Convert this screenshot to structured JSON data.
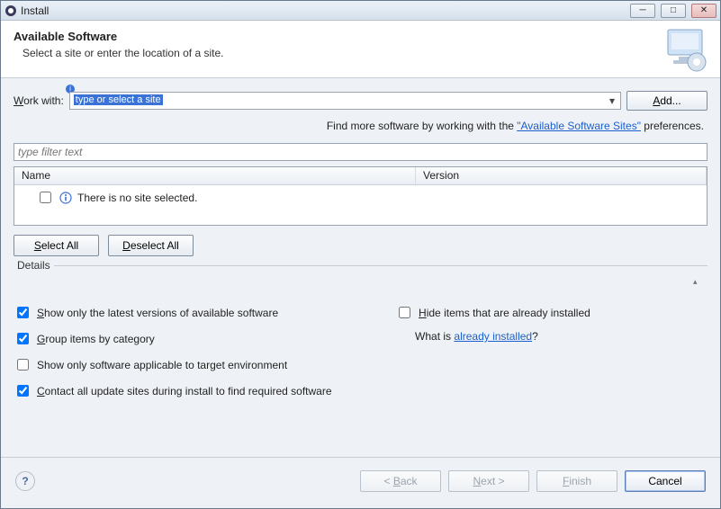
{
  "window": {
    "title": "Install"
  },
  "header": {
    "title": "Available Software",
    "subtitle": "Select a site or enter the location of a site."
  },
  "workwith": {
    "label_pre": "W",
    "label_post": "ork with:",
    "placeholder": "type or select a site",
    "value": ""
  },
  "add_button": "Add...",
  "find_more": {
    "prefix": "Find more software by working with the ",
    "link": "\"Available Software Sites\"",
    "suffix": " preferences."
  },
  "filter": {
    "placeholder": "type filter text"
  },
  "table": {
    "columns": {
      "name": "Name",
      "version": "Version"
    },
    "empty_row": "There is no site selected."
  },
  "buttons": {
    "select_all_u": "S",
    "select_all_rest": "elect All",
    "deselect_all_u": "D",
    "deselect_all_rest": "eselect All"
  },
  "details": {
    "label": "Details"
  },
  "options": {
    "show_latest": {
      "checked": true,
      "pre": "",
      "u": "S",
      "post": "how only the latest versions of available software"
    },
    "hide_installed": {
      "checked": false,
      "pre": "",
      "u": "H",
      "post": "ide items that are already installed"
    },
    "group_category": {
      "checked": true,
      "pre": "",
      "u": "G",
      "post": "roup items by category"
    },
    "what_is": {
      "prefix": "What is ",
      "link": "already installed",
      "suffix": "?"
    },
    "target_env": {
      "checked": false,
      "text": "Show only software applicable to target environment"
    },
    "contact_sites": {
      "checked": true,
      "pre": "",
      "u": "C",
      "post": "ontact all update sites during install to find required software"
    }
  },
  "footer": {
    "back_u": "B",
    "back_rest": "ack",
    "next_u": "N",
    "next_rest": "ext >",
    "finish_u": "F",
    "finish_rest": "inish",
    "cancel": "Cancel"
  }
}
